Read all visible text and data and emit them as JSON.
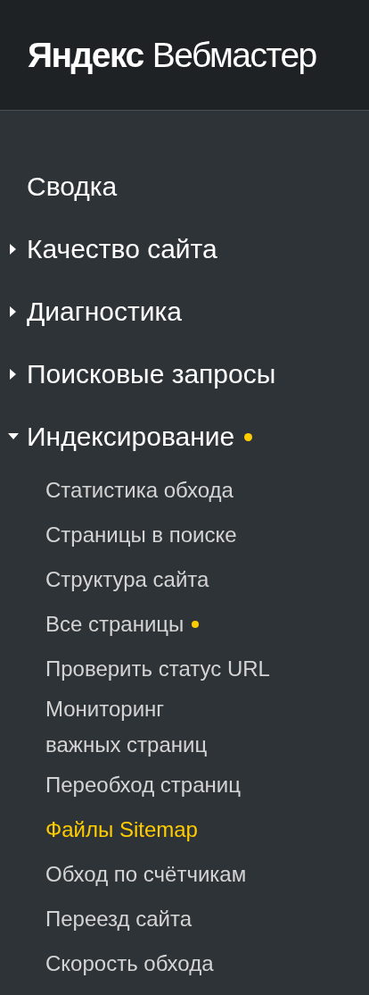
{
  "logo": {
    "brand": "Яндекс",
    "product": "Вебмастер"
  },
  "menu": [
    {
      "kind": "link",
      "label": "Сводка",
      "dot": false
    },
    {
      "kind": "group",
      "label": "Качество сайта",
      "expanded": false,
      "dot": false
    },
    {
      "kind": "group",
      "label": "Диагностика",
      "expanded": false,
      "dot": false
    },
    {
      "kind": "group",
      "label": "Поисковые запросы",
      "expanded": false,
      "dot": false
    },
    {
      "kind": "group",
      "label": "Индексирование",
      "expanded": true,
      "dot": true,
      "children": [
        {
          "label": "Статистика обхода",
          "selected": false,
          "dot": false
        },
        {
          "label": "Страницы в поиске",
          "selected": false,
          "dot": false
        },
        {
          "label": "Структура сайта",
          "selected": false,
          "dot": false
        },
        {
          "label": "Все страницы",
          "selected": false,
          "dot": true
        },
        {
          "label": "Проверить статус URL",
          "selected": false,
          "dot": false
        },
        {
          "label": "Мониторинг\nважных страниц",
          "selected": false,
          "dot": false
        },
        {
          "label": "Переобход страниц",
          "selected": false,
          "dot": false
        },
        {
          "label": "Файлы Sitemap",
          "selected": true,
          "dot": false
        },
        {
          "label": "Обход по счётчикам",
          "selected": false,
          "dot": false
        },
        {
          "label": "Переезд сайта",
          "selected": false,
          "dot": false
        },
        {
          "label": "Скорость обхода",
          "selected": false,
          "dot": false
        }
      ]
    }
  ]
}
